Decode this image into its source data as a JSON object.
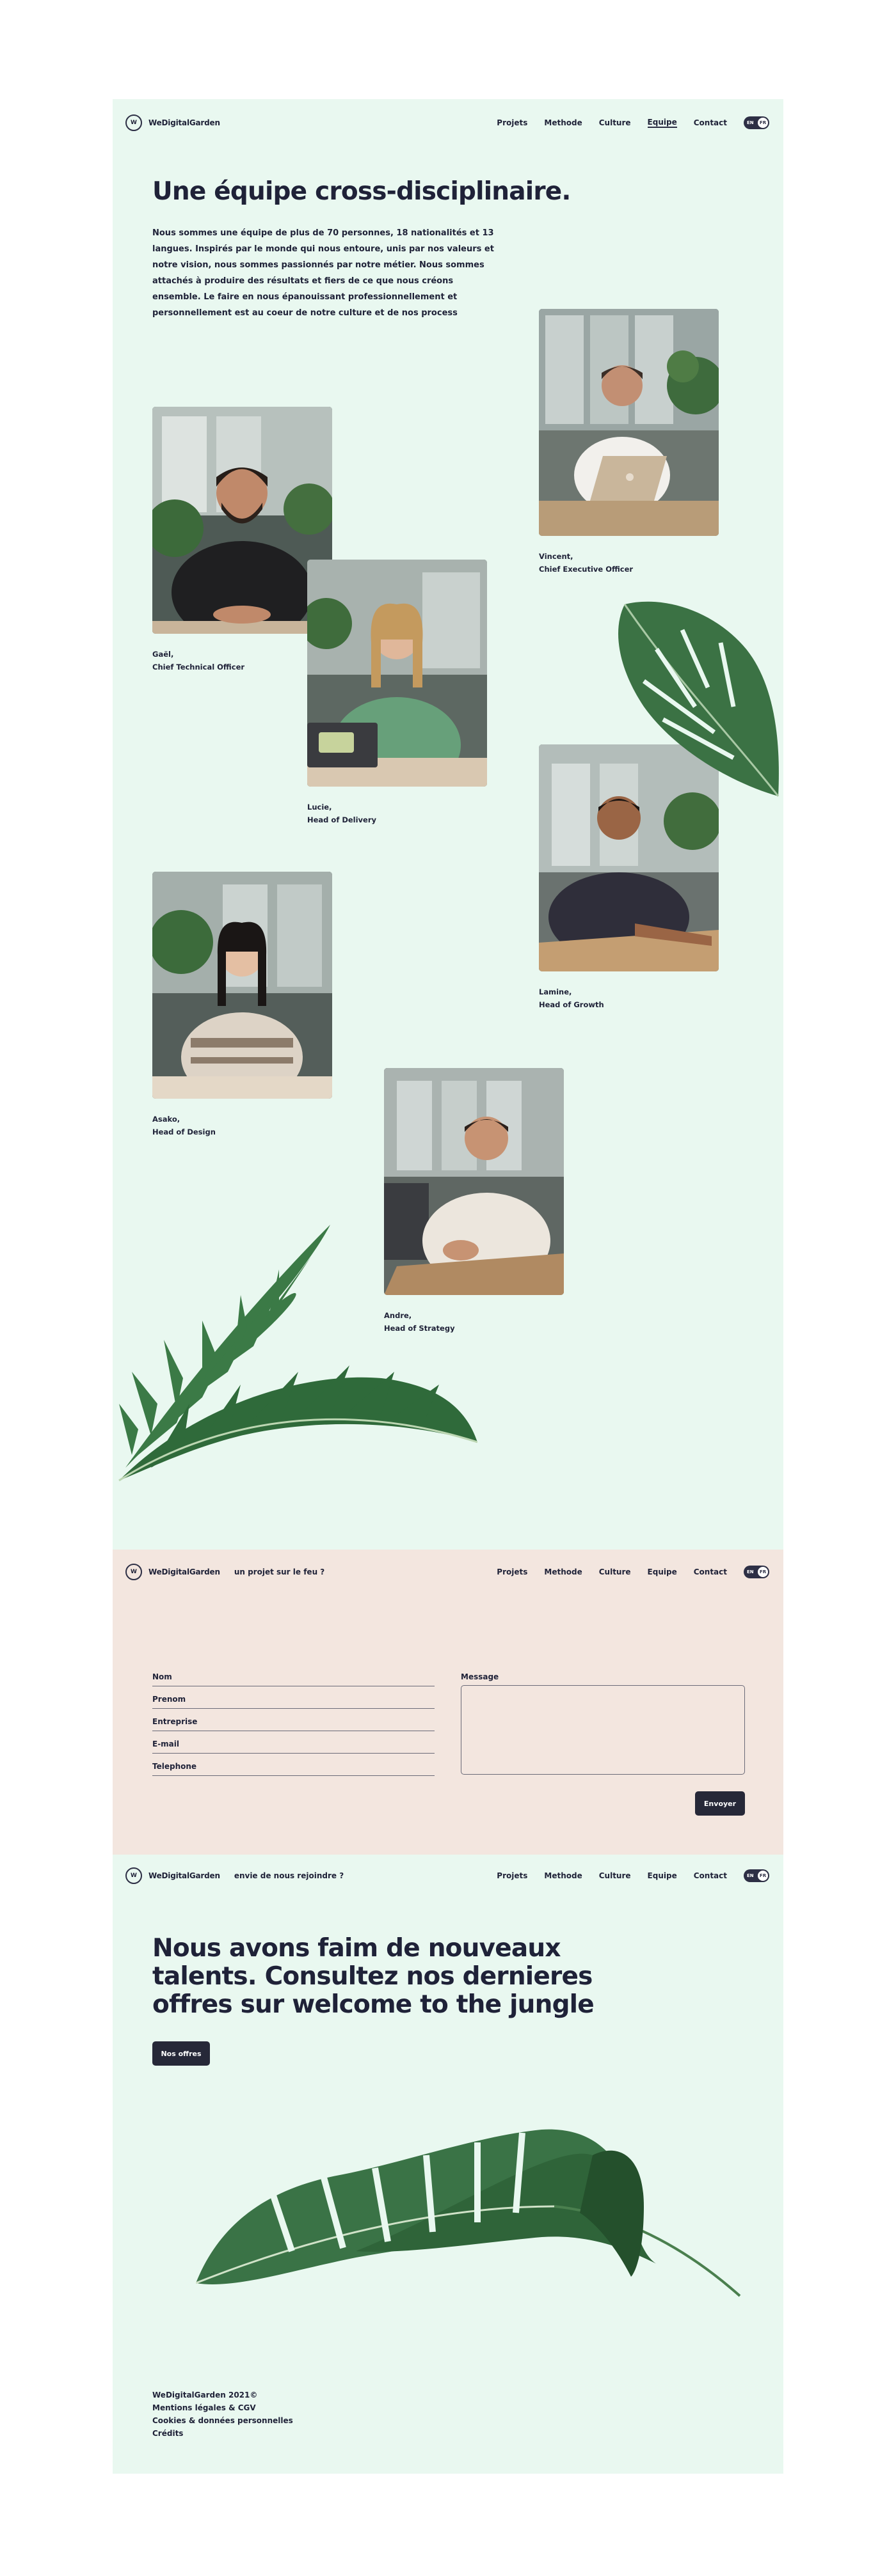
{
  "brand": {
    "name": "WeDigitalGarden",
    "mark": "W"
  },
  "nav_links": [
    "Projets",
    "Methode",
    "Culture",
    "Equipe",
    "Contact"
  ],
  "lang": {
    "left": "EN",
    "right": "FR"
  },
  "team": {
    "title": "Une équipe cross-disciplinaire.",
    "intro": "Nous sommes une équipe de plus de 70 personnes, 18 nationalités et 13 langues. Inspirés par le monde qui nous entoure, unis par nos valeurs et notre vision, nous sommes passionnés par notre métier. Nous sommes attachés à produire des résultats et fiers de ce que nous créons ensemble. Le faire en nous épanouissant professionnellement et personnellement est au coeur de notre culture et de nos process",
    "members": [
      {
        "name": "Vincent,",
        "role": "Chief Executive Officer"
      },
      {
        "name": "Gaël,",
        "role": "Chief Technical Officer"
      },
      {
        "name": "Lucie,",
        "role": "Head of Delivery"
      },
      {
        "name": "Lamine,",
        "role": "Head of Growth"
      },
      {
        "name": "Asako,",
        "role": "Head of Design"
      },
      {
        "name": "Andre,",
        "role": "Head of Strategy"
      }
    ]
  },
  "contact": {
    "tagline": "un projet sur le feu ?",
    "fields": [
      "Nom",
      "Prenom",
      "Entreprise",
      "E-mail",
      "Telephone"
    ],
    "message_label": "Message",
    "submit": "Envoyer"
  },
  "careers": {
    "tagline": "envie de nous rejoindre ?",
    "title": "Nous avons faim de nouveaux talents. Consultez nos dernieres offres sur welcome to the jungle",
    "button": "Nos offres"
  },
  "footer": [
    "WeDigitalGarden 2021©",
    "Mentions légales & CGV",
    "Cookies & données personnelles",
    "Crédits"
  ],
  "colors": {
    "mint": "#e9f8f0",
    "peach": "#f3e6df",
    "navy": "#262838",
    "leaf": "#3f7a4a"
  }
}
